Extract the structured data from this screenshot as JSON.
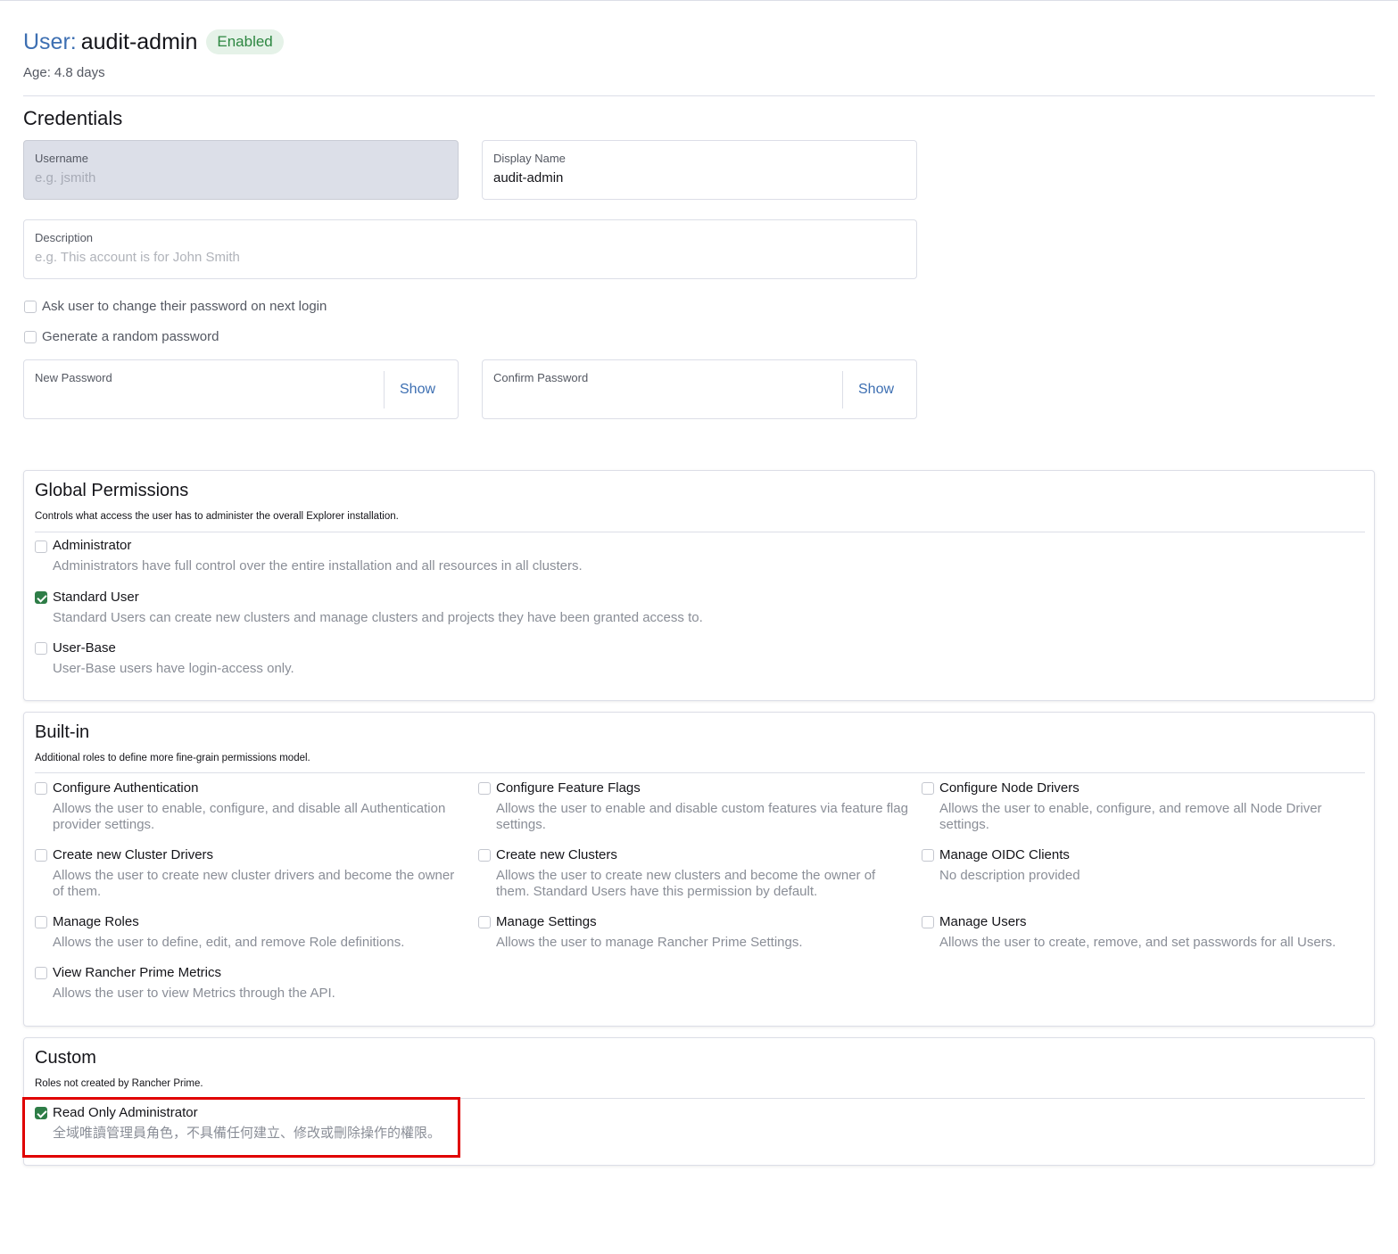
{
  "header": {
    "title_prefix": "User:",
    "title_name": "audit-admin",
    "status_badge": "Enabled",
    "age_label": "Age:",
    "age_value": "4.8 days"
  },
  "credentials": {
    "section_title": "Credentials",
    "username": {
      "label": "Username",
      "placeholder": "e.g. jsmith",
      "value": ""
    },
    "display_name": {
      "label": "Display Name",
      "placeholder": "",
      "value": "audit-admin"
    },
    "description": {
      "label": "Description",
      "placeholder": "e.g. This account is for John Smith",
      "value": ""
    },
    "ask_change_password": {
      "label": "Ask user to change their password on next login",
      "checked": false
    },
    "random_password": {
      "label": "Generate a random password",
      "checked": false
    },
    "new_password": {
      "label": "New Password",
      "show_label": "Show"
    },
    "confirm_password": {
      "label": "Confirm Password",
      "show_label": "Show"
    }
  },
  "global_permissions": {
    "title": "Global Permissions",
    "subtitle": "Controls what access the user has to administer the overall Explorer installation.",
    "options": [
      {
        "label": "Administrator",
        "description": "Administrators have full control over the entire installation and all resources in all clusters.",
        "checked": false
      },
      {
        "label": "Standard User",
        "description": "Standard Users can create new clusters and manage clusters and projects they have been granted access to.",
        "checked": true
      },
      {
        "label": "User-Base",
        "description": "User-Base users have login-access only.",
        "checked": false
      }
    ]
  },
  "builtin": {
    "title": "Built-in",
    "subtitle": "Additional roles to define more fine-grain permissions model.",
    "roles": [
      {
        "label": "Configure Authentication",
        "description": "Allows the user to enable, configure, and disable all Authentication provider settings.",
        "checked": false
      },
      {
        "label": "Configure Feature Flags",
        "description": "Allows the user to enable and disable custom features via feature flag settings.",
        "checked": false
      },
      {
        "label": "Configure Node Drivers",
        "description": "Allows the user to enable, configure, and remove all Node Driver settings.",
        "checked": false
      },
      {
        "label": "Create new Cluster Drivers",
        "description": "Allows the user to create new cluster drivers and become the owner of them.",
        "checked": false
      },
      {
        "label": "Create new Clusters",
        "description": "Allows the user to create new clusters and become the owner of them. Standard Users have this permission by default.",
        "checked": false
      },
      {
        "label": "Manage OIDC Clients",
        "description": "No description provided",
        "checked": false
      },
      {
        "label": "Manage Roles",
        "description": "Allows the user to define, edit, and remove Role definitions.",
        "checked": false
      },
      {
        "label": "Manage Settings",
        "description": "Allows the user to manage Rancher Prime Settings.",
        "checked": false
      },
      {
        "label": "Manage Users",
        "description": "Allows the user to create, remove, and set passwords for all Users.",
        "checked": false
      },
      {
        "label": "View Rancher Prime Metrics",
        "description": "Allows the user to view Metrics through the API.",
        "checked": false
      }
    ]
  },
  "custom": {
    "title": "Custom",
    "subtitle": "Roles not created by Rancher Prime.",
    "roles": [
      {
        "label": "Read Only Administrator",
        "description": "全域唯讀管理員角色，不具備任何建立、修改或刪除操作的權限。",
        "checked": true
      }
    ]
  },
  "colors": {
    "link_blue": "#3d6fb2",
    "badge_green_text": "#2d8741",
    "badge_green_bg": "#e5f2e8",
    "checkbox_checked": "#2e7d47",
    "highlight_red": "#e00000"
  }
}
